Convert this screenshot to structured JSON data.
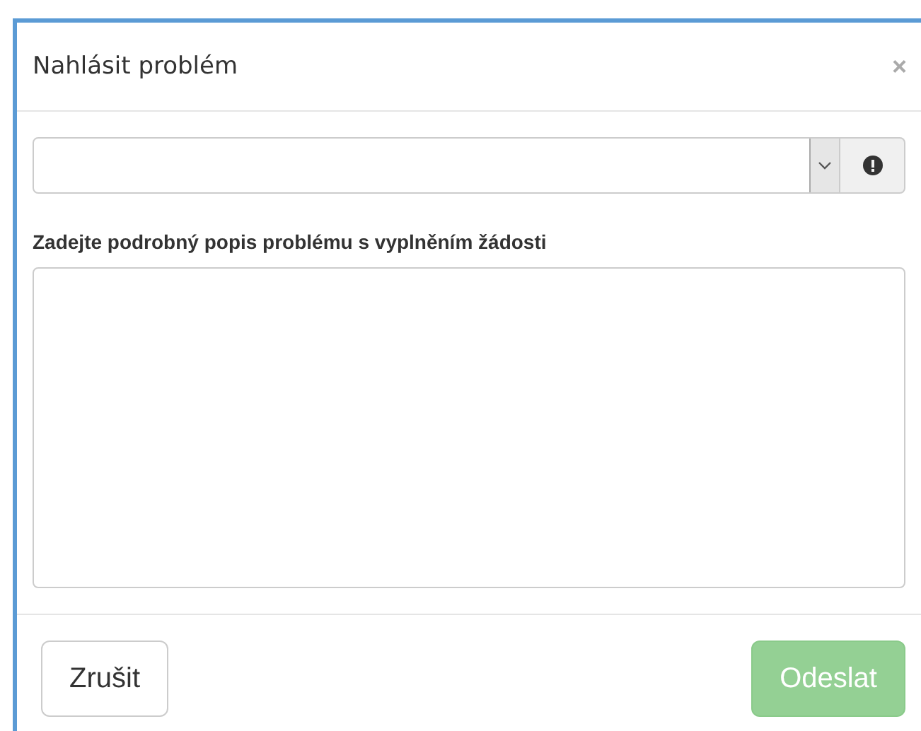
{
  "dialog": {
    "title": "Nahlásit problém",
    "close": "×"
  },
  "description": {
    "label": "Zadejte podrobný popis problému s vyplněním žádosti"
  },
  "buttons": [
    {
      "label": "Zrušit",
      "kind": "default",
      "disabled": false
    },
    {
      "label": "Odeslat",
      "kind": "primary",
      "disabled": true
    }
  ]
}
